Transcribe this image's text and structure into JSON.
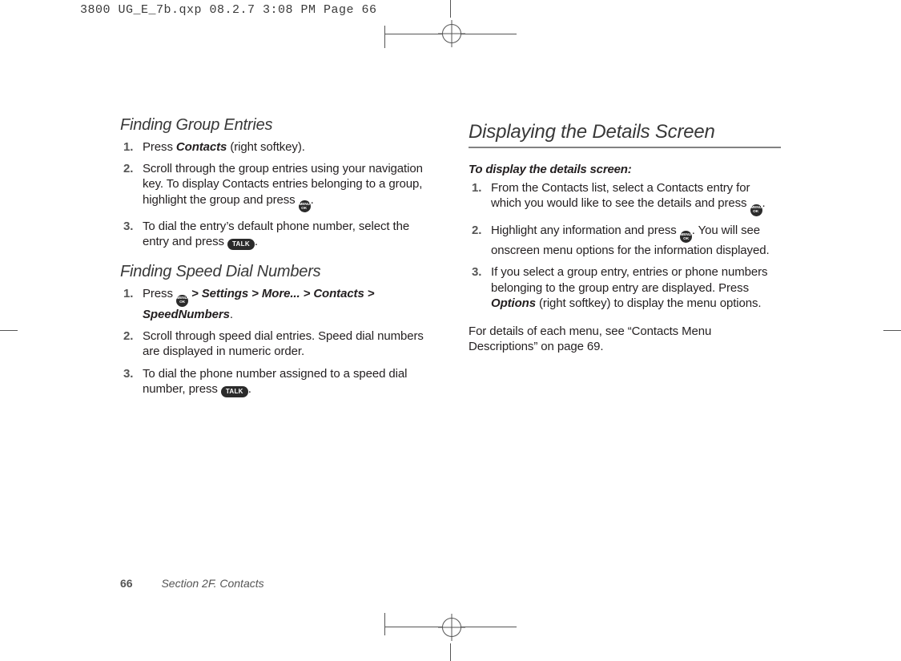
{
  "prepress": {
    "header": "3800 UG_E_7b.qxp  08.2.7  3:08 PM  Page 66"
  },
  "left": {
    "group": {
      "heading": "Finding Group Entries",
      "steps": {
        "s1": {
          "pre": "Press ",
          "bi": "Contacts",
          "post": " (right softkey)."
        },
        "s2": {
          "pre": "Scroll through the group entries using your navigation key. To display Contacts entries belonging to a group, highlight the group and press ",
          "post": "."
        },
        "s3": {
          "pre": "To dial the entry’s default phone number, select the entry and press ",
          "post": "."
        }
      }
    },
    "speed": {
      "heading": "Finding Speed Dial Numbers",
      "steps": {
        "s1": {
          "pre": "Press ",
          "bi": " > Settings > More... > Contacts > SpeedNumbers",
          "post": "."
        },
        "s2": {
          "text": "Scroll through speed dial entries. Speed dial numbers are displayed in numeric order."
        },
        "s3": {
          "pre": "To dial the phone number assigned to a speed dial number, press ",
          "post": "."
        }
      }
    }
  },
  "right": {
    "heading": "Displaying the Details Screen",
    "lead": "To display the details screen:",
    "steps": {
      "s1": {
        "pre": "From the Contacts list, select a Contacts entry for which you would like to see the details and press ",
        "post": "."
      },
      "s2": {
        "pre": "Highlight any information and press ",
        "post": ". You will see onscreen menu options for the information displayed."
      },
      "s3": {
        "pre": "If you select a group entry, entries or phone numbers belonging to the group entry are displayed. Press ",
        "bi": "Options",
        "post": " (right softkey) to display the menu options."
      }
    },
    "tail": "For details of each menu, see “Contacts Menu Descriptions” on page 69."
  },
  "footer": {
    "page": "66",
    "section": "Section 2F. Contacts"
  },
  "icons": {
    "menu_top": "MENU",
    "menu_bottom": "OK",
    "talk": "TALK"
  }
}
